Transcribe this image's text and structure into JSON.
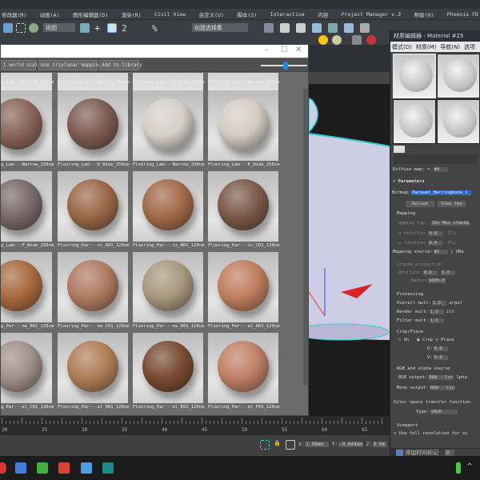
{
  "menu": [
    "修改器(M)",
    "动画(A)",
    "图形编辑器(D)",
    "渲染(R)",
    "Civil View",
    "自定义(U)",
    "脚本(S)",
    "Interactive",
    "内容",
    "Project Manager v.3",
    "帮助(H)",
    "Phoenix FD"
  ],
  "toolbar": {
    "view_dropdown": "视图",
    "selection_set": "创建选择集"
  },
  "browser": {
    "buttons": [
      "l world scale",
      "Use triplanar mapping",
      "Add to library"
    ],
    "title_controls": [
      "–",
      "☐",
      "✕"
    ],
    "top_labels": [
      "g_Lam···A_Wide_250cm",
      "Flooring_Lam···Narrow_250cm",
      "Flooring_Lam···B_Wide_250cm",
      "Flooring_Lam···Narrow_250cm"
    ],
    "rows": [
      [
        {
          "label": "g_Lam···Narrow_250cm",
          "color": "#8a6458"
        },
        {
          "label": "Flooring_Lam···D_Wide_250cm",
          "color": "#7e5c52"
        },
        {
          "label": "Flooring_Lam···Narrow_250cm",
          "color": "#d6cfc8"
        },
        {
          "label": "Flooring_Lam···E_Wide_250cm",
          "color": "#d4ccc4"
        }
      ],
      [
        {
          "label": "g_Lam···F_Wide_250cm",
          "color": "#7a6a6a"
        },
        {
          "label": "Flooring_Par···ic_A01_120cm",
          "color": "#9a6848"
        },
        {
          "label": "Flooring_Par···ic_B01_120cm",
          "color": "#a26a4a"
        },
        {
          "label": "Flooring_Par···ic_C01_120cm",
          "color": "#7c5a4a"
        }
      ],
      [
        {
          "label": "g_Par···ne_B01_120cm",
          "color": "#a86a40"
        },
        {
          "label": "Flooring_Par···ne_C01_120cm",
          "color": "#b07a62"
        },
        {
          "label": "Flooring_Par···ne_D01_120cm",
          "color": "#a8987e"
        },
        {
          "label": "Flooring_Par···el_A01_120cm",
          "color": "#c07e60"
        }
      ],
      [
        {
          "label": "g_Par···el_C01_120cm",
          "color": "#a09088"
        },
        {
          "label": "Flooring_Par···el_D01_120cm",
          "color": "#b07e58"
        },
        {
          "label": "Flooring_Par···el_E01_120cm",
          "color": "#7a4c32"
        },
        {
          "label": "Flooring_Par···el_F01_120cm",
          "color": "#c08068"
        }
      ]
    ]
  },
  "material_editor": {
    "title": "材质编辑器 - Material #25",
    "menu": [
      "模式(D)",
      "材质(M)",
      "导航(N)",
      "选项"
    ],
    "diffuse_label": "Diffuse map:",
    "diffuse_value": "#4",
    "params_title": "Parameters",
    "bitmap_label": "Bitmap:",
    "bitmap_value": "Parquet_Herringbone_C_",
    "reload": "Reload",
    "view_image": "View ima",
    "mapping": "Mapping",
    "mapping_type_label": "apping typ·",
    "mapping_type": "3ds Max standa",
    "u_rot_label": "u rotation",
    "u_rot": "0.0",
    "v_rot_label": "v rotation",
    "v_rot": "0.0",
    "flip": ": Fli",
    "mapping_source_label": "Mapping source:",
    "mapping_source": "#2",
    "mapping_source_extra": "( VRa",
    "ground": "Ground projection",
    "position_label": "Position:",
    "position": "0.0",
    "position2": "0.0",
    "radius_label": "Radius",
    "radius": "1000.0",
    "processing": "Processing",
    "overall_label": "Overall mult:",
    "overall": "1.0",
    "interp": "erpol",
    "render_label": "Render mult:",
    "render": "1.0",
    "ilt": "ilt",
    "filter_label": "Filter mult:",
    "filter": "1.0",
    "crop": "Crop/Place",
    "on": "On",
    "crop_opt": "Crop",
    "place_opt": "Place",
    "u_label": "U:",
    "u": "0.0",
    "v_label": "V:",
    "v": "0.0",
    "rgb_alpha": "RGB and alpha source",
    "rgb_out_label": "RGB output:",
    "rgb_out": "RGB···lor",
    "alpha": "lpha",
    "mono_label": "Mono output:",
    "mono": "RGB···ity",
    "color_space": "Color space transfer function",
    "type_label": "Type:",
    "type": "sRGB",
    "viewport": "Viewport",
    "full_res": "Use full resolution for vi"
  },
  "timeline": {
    "ticks": [
      "20",
      "25",
      "30",
      "35",
      "40",
      "45",
      "50",
      "55",
      "60",
      "65"
    ]
  },
  "status": {
    "x_label": "X:",
    "x": "1.98mm",
    "y_label": "Y:",
    "y": "-0.044mm",
    "z_label": "Z:",
    "z": "0.0m",
    "add_time_tag": "添加时间标记",
    "frame": "0"
  }
}
